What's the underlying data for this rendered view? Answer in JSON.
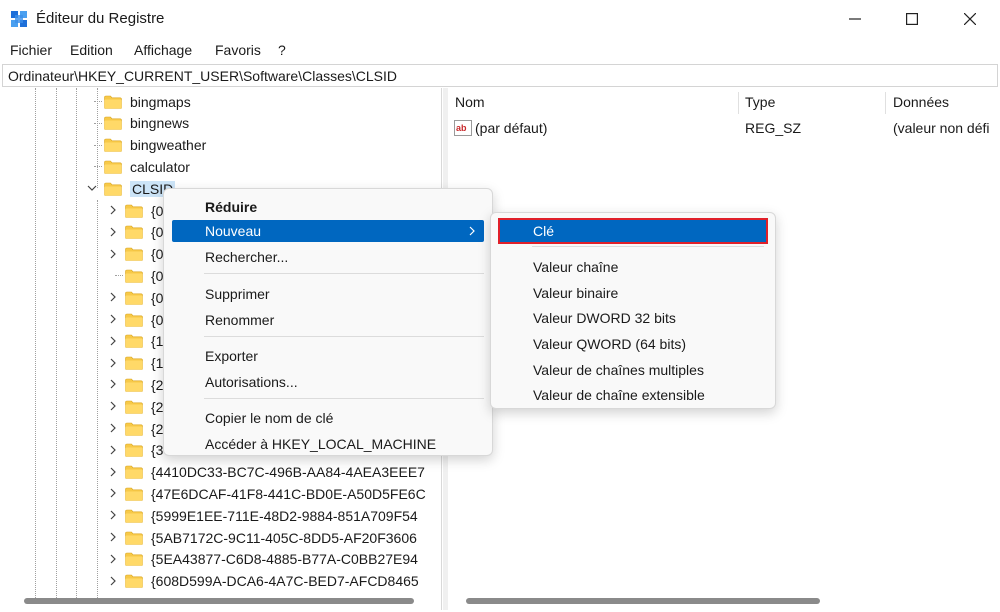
{
  "window": {
    "title": "Éditeur du Registre"
  },
  "menubar": {
    "items": [
      "Fichier",
      "Edition",
      "Affichage",
      "Favoris",
      "?"
    ]
  },
  "address": {
    "path": "Ordinateur\\HKEY_CURRENT_USER\\Software\\Classes\\CLSID"
  },
  "tree": {
    "items": [
      {
        "label": "bingmaps",
        "expandable": false
      },
      {
        "label": "bingnews",
        "expandable": false
      },
      {
        "label": "bingweather",
        "expandable": false
      },
      {
        "label": "calculator",
        "expandable": false
      },
      {
        "label": "CLSID",
        "expandable": true,
        "expanded": true,
        "selected": true
      }
    ],
    "children": [
      {
        "label": "{0",
        "expandable": true
      },
      {
        "label": "{0",
        "expandable": true
      },
      {
        "label": "{0",
        "expandable": true
      },
      {
        "label": "{0",
        "expandable": false
      },
      {
        "label": "{0",
        "expandable": true
      },
      {
        "label": "{0",
        "expandable": true
      },
      {
        "label": "{1",
        "expandable": true
      },
      {
        "label": "{1",
        "expandable": true
      },
      {
        "label": "{2",
        "expandable": true
      },
      {
        "label": "{2",
        "expandable": true
      },
      {
        "label": "{2",
        "expandable": true
      },
      {
        "label": "{3",
        "expandable": true
      },
      {
        "label": "{4410DC33-BC7C-496B-AA84-4AEA3EEE7",
        "expandable": true
      },
      {
        "label": "{47E6DCAF-41F8-441C-BD0E-A50D5FE6C",
        "expandable": true
      },
      {
        "label": "{5999E1EE-711E-48D2-9884-851A709F54",
        "expandable": true
      },
      {
        "label": "{5AB7172C-9C11-405C-8DD5-AF20F3606",
        "expandable": true
      },
      {
        "label": "{5EA43877-C6D8-4885-B77A-C0BB27E94",
        "expandable": true
      },
      {
        "label": "{608D599A-DCA6-4A7C-BED7-AFCD8465",
        "expandable": true
      }
    ]
  },
  "list": {
    "columns": [
      "Nom",
      "Type",
      "Données"
    ],
    "rows": [
      {
        "name": "(par défaut)",
        "type": "REG_SZ",
        "data": "(valeur non défi",
        "icon": "string-value-icon"
      }
    ]
  },
  "context_menu": {
    "items": [
      "Réduire",
      "Nouveau",
      "Rechercher...",
      "Supprimer",
      "Renommer",
      "Exporter",
      "Autorisations...",
      "Copier le nom de clé",
      "Accéder à HKEY_LOCAL_MACHINE"
    ]
  },
  "submenu": {
    "items": [
      "Clé",
      "Valeur chaîne",
      "Valeur binaire",
      "Valeur DWORD 32 bits",
      "Valeur QWORD (64 bits)",
      "Valeur de chaînes multiples",
      "Valeur de chaîne extensible"
    ]
  },
  "colors": {
    "highlight": "#0067c0",
    "highlight_outline": "#e0202a",
    "folder": "#f7c948"
  }
}
